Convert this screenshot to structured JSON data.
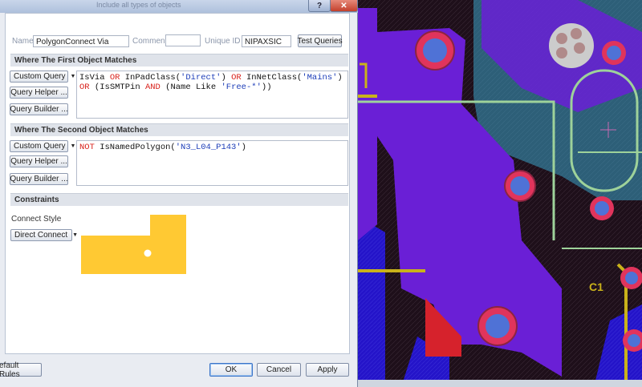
{
  "dialog": {
    "help_glyph": "?",
    "close_glyph": "✕",
    "bg_title_text": "Include all types of objects"
  },
  "rule": {
    "name_label": "Name",
    "name_value": "PolygonConnect Via",
    "comment_label": "Comment",
    "comment_value": "",
    "uid_label": "Unique ID",
    "uid_value": "NIPAXSIC",
    "test_queries_label": "Test Queries"
  },
  "first_object": {
    "header": "Where The First Object Matches",
    "mode_label": "Custom Query",
    "helper_label": "Query Helper ...",
    "builder_label": "Query Builder ...",
    "tokens": [
      {
        "t": "IsVia ",
        "c": "fn"
      },
      {
        "t": "OR",
        "c": "kw"
      },
      {
        "t": " InPadClass(",
        "c": "fn"
      },
      {
        "t": "'Direct'",
        "c": "str"
      },
      {
        "t": ") ",
        "c": "fn"
      },
      {
        "t": "OR",
        "c": "kw"
      },
      {
        "t": " InNetClass(",
        "c": "fn"
      },
      {
        "t": "'Mains'",
        "c": "str"
      },
      {
        "t": ") ",
        "c": "fn"
      },
      {
        "t": "OR",
        "c": "kw"
      },
      {
        "t": " ",
        "c": "fn"
      },
      {
        "t": "(IsSMTPin ",
        "c": "fn"
      },
      {
        "t": "AND",
        "c": "kw"
      },
      {
        "t": " (Name Like ",
        "c": "fn"
      },
      {
        "t": "'Free-*'",
        "c": "str"
      },
      {
        "t": "))",
        "c": "fn"
      }
    ]
  },
  "second_object": {
    "header": "Where The Second Object Matches",
    "mode_label": "Custom Query",
    "helper_label": "Query Helper ...",
    "builder_label": "Query Builder ...",
    "tokens": [
      {
        "t": "NOT",
        "c": "kw"
      },
      {
        "t": " IsNamedPolygon(",
        "c": "fn"
      },
      {
        "t": "'N3_L04_P143'",
        "c": "str"
      },
      {
        "t": ")",
        "c": "fn"
      }
    ]
  },
  "constraints": {
    "header": "Constraints",
    "connect_style_label": "Connect Style",
    "connect_style_value": "Direct Connect",
    "preview_color": "#ffc933"
  },
  "footer": {
    "default_rules_label": "efault Rules",
    "ok_label": "OK",
    "cancel_label": "Cancel",
    "apply_label": "Apply"
  },
  "pcb": {
    "designator_label": "C1"
  },
  "colors": {
    "polygon": "#6a1fd6",
    "via_ring": "#e0345c",
    "via_hole": "#4f72d6",
    "track_yellow": "#c9b21a",
    "track_green": "#9ed29a",
    "bg_dark": "#20101c",
    "bottom_blue": "#2414c9"
  }
}
